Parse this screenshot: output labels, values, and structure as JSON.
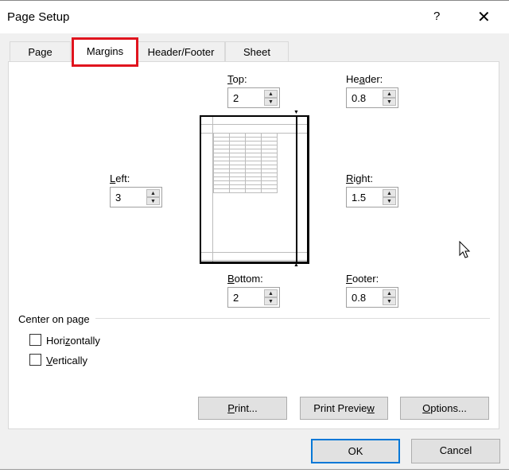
{
  "dialog": {
    "title": "Page Setup",
    "help": "?",
    "close": "✕"
  },
  "tabs": [
    {
      "label": "Page"
    },
    {
      "label": "Margins",
      "selected": true
    },
    {
      "label": "Header/Footer"
    },
    {
      "label": "Sheet"
    }
  ],
  "margins": {
    "top": {
      "pre": "",
      "key": "T",
      "post": "op:",
      "value": "2"
    },
    "header": {
      "pre": "He",
      "key": "a",
      "post": "der:",
      "value": "0.8"
    },
    "left": {
      "pre": "",
      "key": "L",
      "post": "eft:",
      "value": "3"
    },
    "right": {
      "pre": "",
      "key": "R",
      "post": "ight:",
      "value": "1.5"
    },
    "bottom": {
      "pre": "",
      "key": "B",
      "post": "ottom:",
      "value": "2"
    },
    "footer": {
      "pre": "",
      "key": "F",
      "post": "ooter:",
      "value": "0.8"
    }
  },
  "center": {
    "title": "Center on page",
    "horizontally": {
      "pre": "Hori",
      "key": "z",
      "post": "ontally",
      "checked": false
    },
    "vertically": {
      "pre": "",
      "key": "V",
      "post": "ertically",
      "checked": false
    }
  },
  "buttons": {
    "print": {
      "pre": "",
      "key": "P",
      "post": "rint..."
    },
    "preview": {
      "pre": "Print Previe",
      "key": "w",
      "post": ""
    },
    "options": {
      "pre": "",
      "key": "O",
      "post": "ptions..."
    },
    "ok": "OK",
    "cancel": "Cancel"
  },
  "colors": {
    "highlight": "#e0141e",
    "focus": "#0078d7"
  }
}
